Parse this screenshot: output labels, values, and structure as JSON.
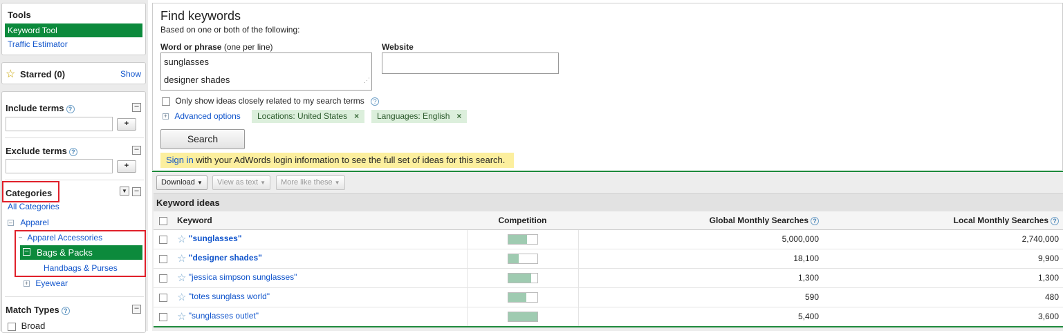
{
  "sidebar": {
    "tools_title": "Tools",
    "tools": [
      "Keyword Tool",
      "Traffic Estimator"
    ],
    "starred_label": "Starred (0)",
    "starred_show": "Show",
    "include_terms": "Include terms",
    "exclude_terms": "Exclude terms",
    "add_label": "+",
    "categories_title": "Categories",
    "categories": {
      "all": "All Categories",
      "apparel": "Apparel",
      "apparel_accessories": "Apparel Accessories",
      "bags_packs": "Bags & Packs",
      "handbags_purses": "Handbags & Purses",
      "eyewear": "Eyewear"
    },
    "match_types_title": "Match Types",
    "match_broad": "Broad"
  },
  "find": {
    "title": "Find keywords",
    "subtitle": "Based on one or both of the following:",
    "word_label": "Word or phrase",
    "word_hint": "(one per line)",
    "word_lines": [
      "sunglasses",
      "designer shades"
    ],
    "website_label": "Website",
    "website_value": "",
    "only_show": "Only show ideas closely related to my search terms",
    "advanced": "Advanced options",
    "chip_location": "Locations: United States",
    "chip_language": "Languages: English",
    "chip_remove": "×",
    "search_button": "Search",
    "signin_link": "Sign in",
    "signin_text": " with your AdWords login information to see the full set of ideas for this search."
  },
  "toolbar": {
    "download": "Download",
    "view_as_text": "View as text",
    "more_like_these": "More like these"
  },
  "results": {
    "section_title": "Keyword ideas",
    "headers": {
      "keyword": "Keyword",
      "competition": "Competition",
      "global": "Global Monthly Searches",
      "local": "Local Monthly Searches"
    },
    "rows": [
      {
        "keyword": "\"sunglasses\"",
        "competition": 0.65,
        "global": "5,000,000",
        "local": "2,740,000"
      },
      {
        "keyword": "\"designer shades\"",
        "competition": 0.37,
        "global": "18,100",
        "local": "9,900"
      },
      {
        "keyword": "\"jessica simpson sunglasses\"",
        "competition": 0.8,
        "global": "1,300",
        "local": "1,300"
      },
      {
        "keyword": "\"totes sunglass world\"",
        "competition": 0.62,
        "global": "590",
        "local": "480"
      },
      {
        "keyword": "\"sunglasses outlet\"",
        "competition": 1.0,
        "global": "5,400",
        "local": "3,600"
      }
    ]
  },
  "colors": {
    "selected_green": "#0c8a3c",
    "highlight_red": "#e0202a",
    "notice_yellow": "#fcef9e",
    "competition_fill": "#9fcbb1"
  }
}
